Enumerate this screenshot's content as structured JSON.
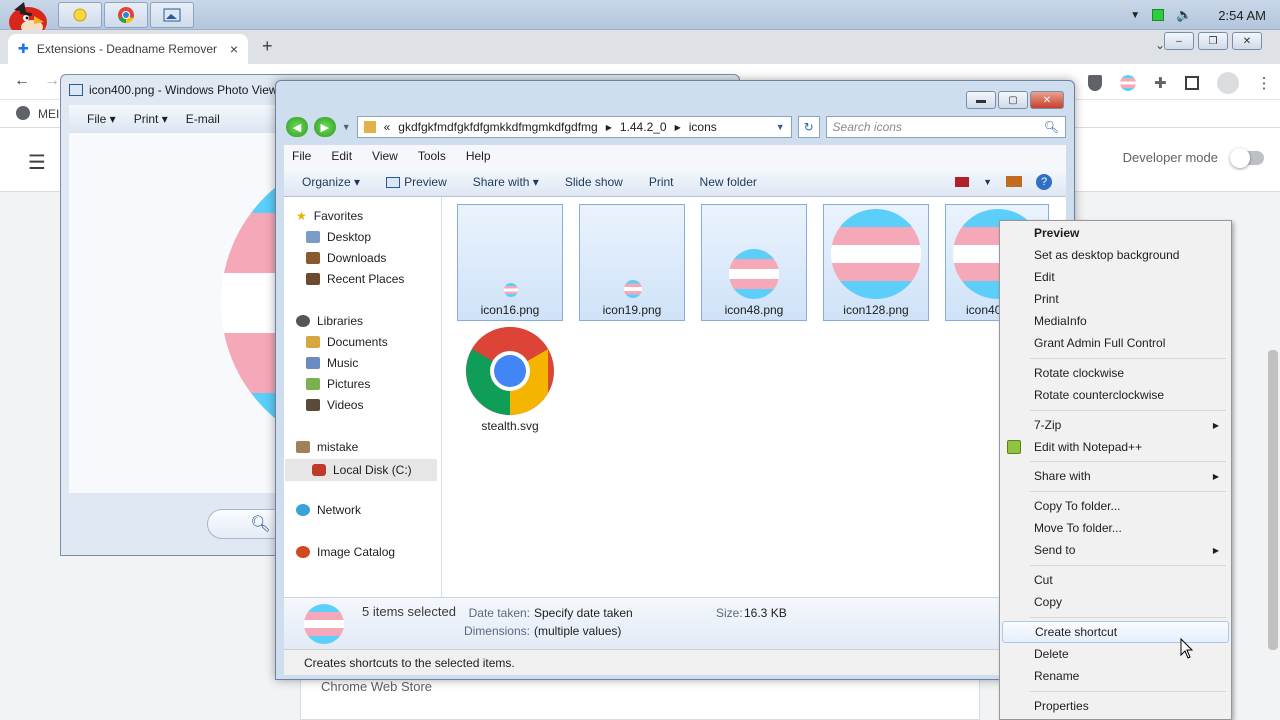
{
  "taskbar": {
    "clock": "2:54 AM"
  },
  "chrome": {
    "tab_title": "Extensions - Deadname Remover",
    "bookmark_label": "MEI",
    "developer_mode_label": "Developer mode",
    "card_text": "Chrome Web Store"
  },
  "photo_viewer": {
    "title": "icon400.png - Windows Photo View",
    "menu": [
      "File",
      "Print",
      "E-mail"
    ]
  },
  "explorer": {
    "breadcrumb": [
      "«",
      "gkdfgkfmdfgkfdfgmkkdfmgmkdfgdfmg",
      "1.44.2_0",
      "icons"
    ],
    "search_placeholder": "Search icons",
    "menu": [
      "File",
      "Edit",
      "View",
      "Tools",
      "Help"
    ],
    "commands": [
      "Organize",
      "Preview",
      "Share with",
      "Slide show",
      "Print",
      "New folder"
    ],
    "nav": {
      "favorites": "Favorites",
      "desktop": "Desktop",
      "downloads": "Downloads",
      "recent": "Recent Places",
      "libraries": "Libraries",
      "documents": "Documents",
      "music": "Music",
      "pictures": "Pictures",
      "videos": "Videos",
      "mistake": "mistake",
      "local_disk": "Local Disk (C:)",
      "network": "Network",
      "image_catalog": "Image Catalog"
    },
    "files": [
      "icon16.png",
      "icon19.png",
      "icon48.png",
      "icon128.png",
      "icon40",
      "stealth.svg"
    ],
    "details": {
      "selected": "5 items selected",
      "date_label": "Date taken:",
      "date_value": "Specify date taken",
      "dims_label": "Dimensions:",
      "dims_value": "(multiple values)",
      "size_label": "Size:",
      "size_value": "16.3 KB"
    },
    "status": "Creates shortcuts to the selected items."
  },
  "context_menu": {
    "items": [
      "Preview",
      "Set as desktop background",
      "Edit",
      "Print",
      "MediaInfo",
      "Grant Admin Full Control",
      "Rotate clockwise",
      "Rotate counterclockwise",
      "7-Zip",
      "Edit with Notepad++",
      "Share with",
      "Copy To folder...",
      "Move To folder...",
      "Send to",
      "Cut",
      "Copy",
      "Create shortcut",
      "Delete",
      "Rename",
      "Properties"
    ]
  }
}
